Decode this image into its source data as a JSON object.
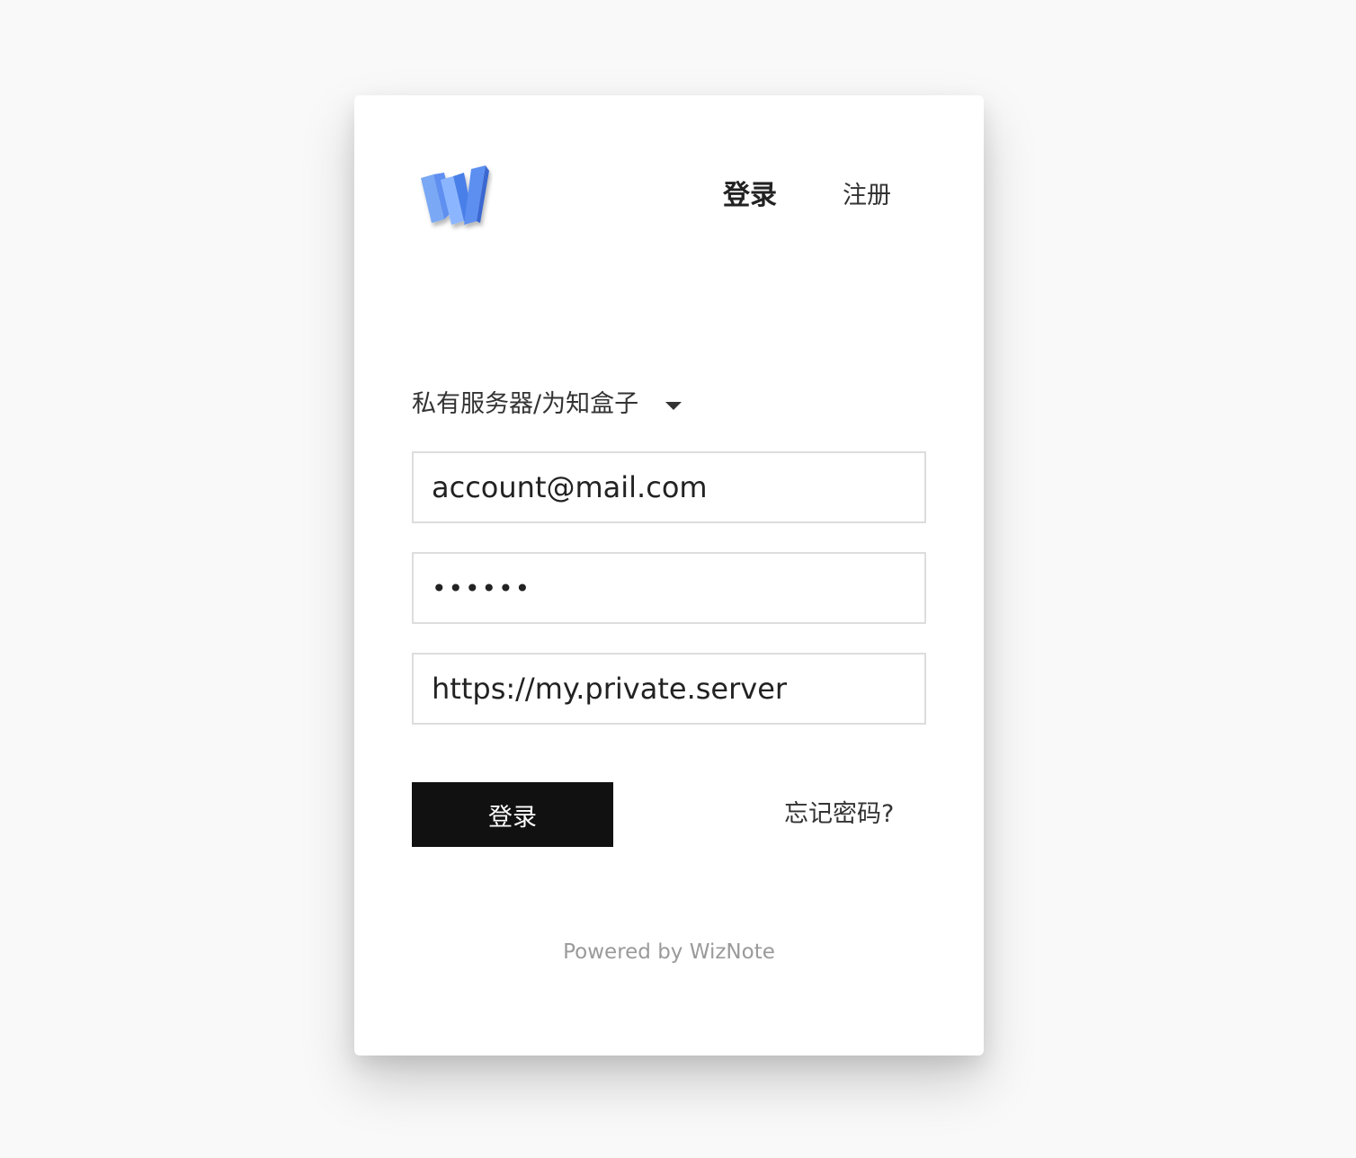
{
  "app": {
    "logo": "wiznote-w-logo",
    "logo_colors": [
      "#5b8ff0",
      "#7ab0ff",
      "#3b6fe0"
    ]
  },
  "tabs": {
    "login_label": "登录",
    "register_label": "注册",
    "active": "login"
  },
  "server_select": {
    "selected": "私有服务器/为知盒子",
    "icon": "caret-down-icon"
  },
  "form": {
    "email_value": "account@mail.com",
    "password_value": "••••••",
    "server_value": "https://my.private.server"
  },
  "actions": {
    "login_button_label": "登录",
    "forgot_password_label": "忘记密码?"
  },
  "footer": {
    "text": "Powered by WizNote"
  },
  "colors": {
    "button_bg": "#111111",
    "input_border": "#dddddd",
    "page_bg": "#f9f9f9"
  }
}
